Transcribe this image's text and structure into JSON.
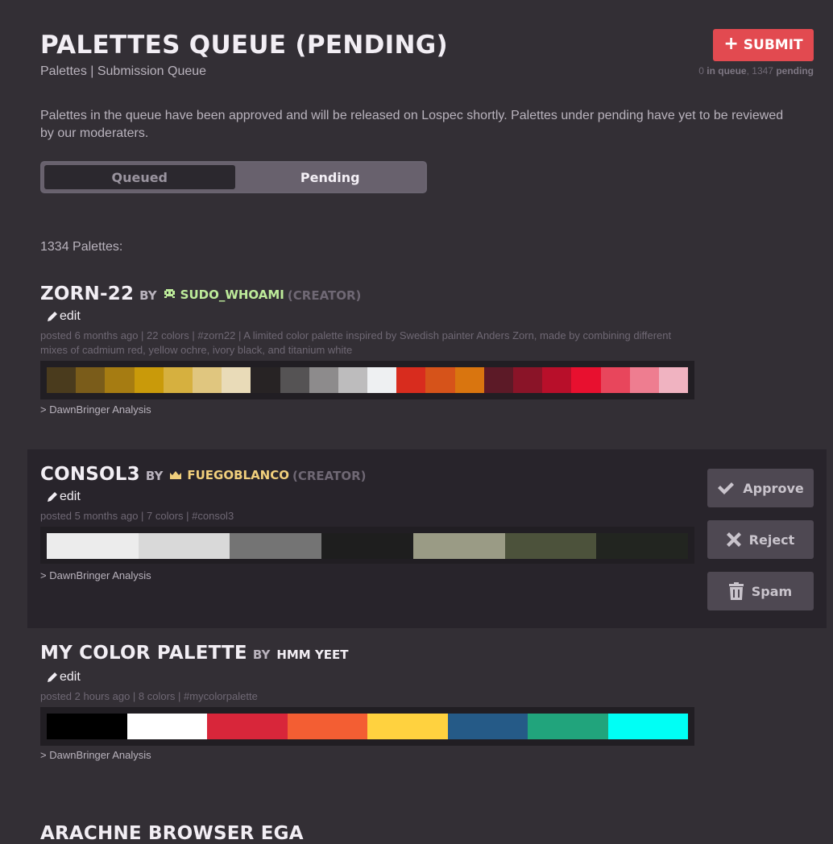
{
  "header": {
    "title": "PALETTES QUEUE (PENDING)",
    "breadcrumb": "Palettes | Submission Queue",
    "submit_label": "SUBMIT",
    "queue_count": "0",
    "queue_label": "in queue",
    "pending_count": "1347",
    "pending_label": "pending"
  },
  "intro_text": "Palettes in the queue have been approved and will be released on Lospec shortly. Palettes under pending have yet to be reviewed by our moderaters.",
  "tabs": [
    {
      "label": "Queued",
      "active": false
    },
    {
      "label": "Pending",
      "active": true
    }
  ],
  "palette_count_label": "1334 Palettes:",
  "palettes": [
    {
      "name": "ZORN-22",
      "by": "BY",
      "author": "SUDO_WHOAMI",
      "author_icon": "alien-icon",
      "author_color": "#bdeb9a",
      "role": "(CREATOR)",
      "edit_label": "edit",
      "meta": "posted 6 months ago | 22 colors | #zorn22 | A limited color palette inspired by Swedish painter Anders Zorn, made by combining different mixes of cadmium red, yellow ochre, ivory black, and titanium white",
      "colors": [
        "#4a3b1d",
        "#7a5c1a",
        "#a67c12",
        "#c99a0a",
        "#d6b03f",
        "#e0c67f",
        "#e9dbb8",
        "#272324",
        "#555354",
        "#8d8b8c",
        "#bdbcbd",
        "#eef0f2",
        "#d82c1e",
        "#d6531a",
        "#d9750f",
        "#5c1a27",
        "#8a1428",
        "#b80f2a",
        "#e8102f",
        "#e8465c",
        "#ee7d90",
        "#f0b3c1"
      ],
      "analysis": "> DawnBringer Analysis"
    },
    {
      "name": "CONSOL3",
      "by": "BY",
      "author": "FUEGOBLANCO",
      "author_icon": "crown-icon",
      "author_color": "#f1cf7c",
      "role": "(CREATOR)",
      "edit_label": "edit",
      "meta": "posted 5 months ago | 7 colors | #consol3",
      "colors": [
        "#ececec",
        "#d9d9d9",
        "#747474",
        "#1e1e1e",
        "#9a9b85",
        "#4c523b",
        "#222520"
      ],
      "analysis": "> DawnBringer Analysis",
      "actions": [
        "Approve",
        "Reject",
        "Spam"
      ]
    },
    {
      "name": "MY COLOR PALETTE",
      "by": "BY",
      "author": "HMM YEET",
      "author_color": "#f2eef4",
      "role": "",
      "edit_label": "edit",
      "meta": "posted 2 hours ago | 8 colors | #mycolorpalette",
      "colors": [
        "#000000",
        "#ffffff",
        "#d8263a",
        "#f35e33",
        "#ffd23f",
        "#255a87",
        "#21a47c",
        "#00fff5"
      ],
      "analysis": "> DawnBringer Analysis"
    }
  ],
  "next_palette_title": "ARACHNE BROWSER EGA"
}
